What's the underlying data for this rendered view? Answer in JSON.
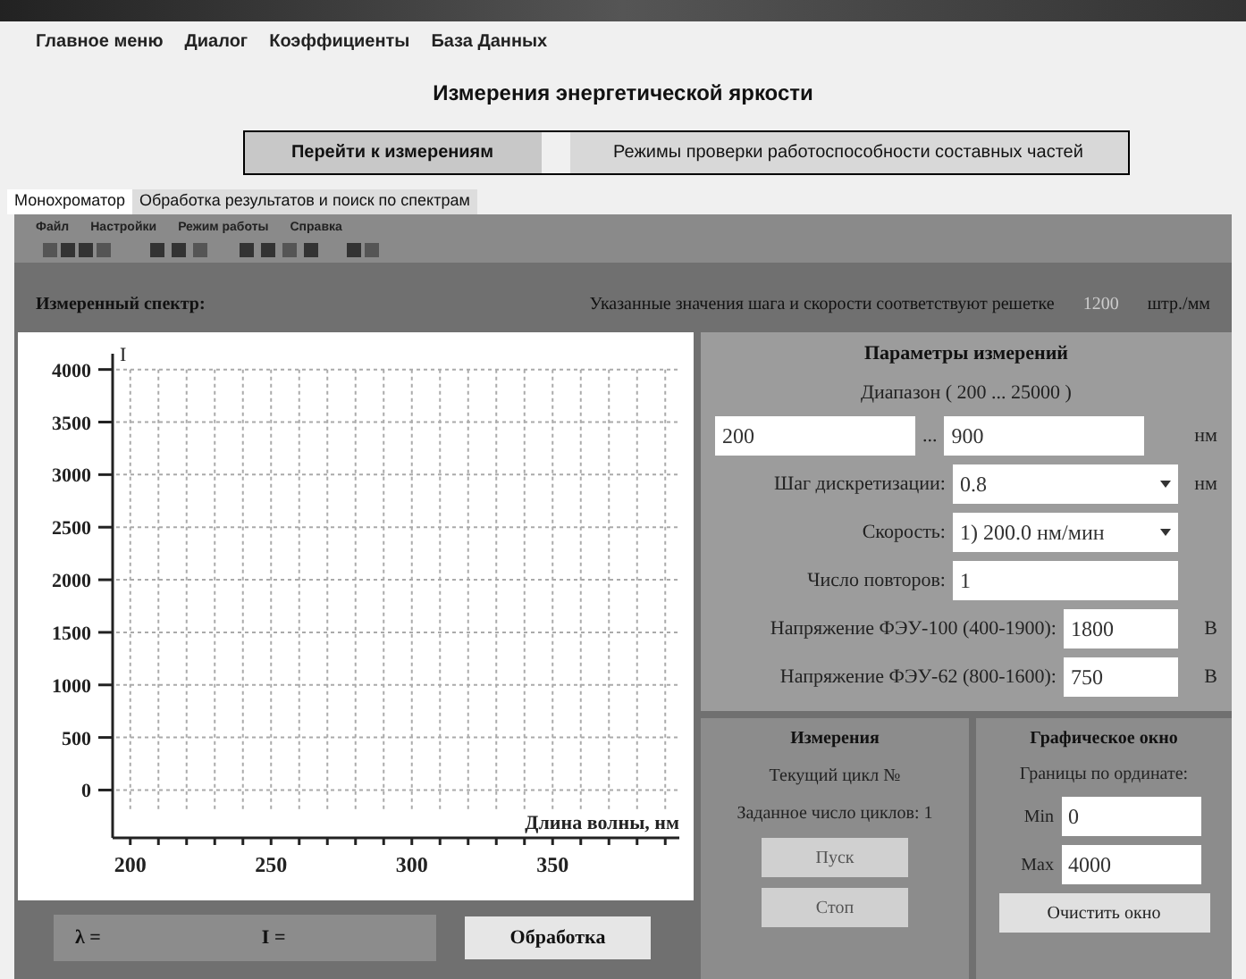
{
  "menu": [
    "Главное меню",
    "Диалог",
    "Коэффициенты",
    "База Данных"
  ],
  "title": "Измерения энергетической яркости",
  "mode_buttons": [
    {
      "label": "Перейти к измерениям",
      "selected": true
    },
    {
      "label": "Режимы проверки работоспособности составных частей",
      "selected": false
    }
  ],
  "tabs": [
    {
      "label": "Монохроматор",
      "selected": true
    },
    {
      "label": "Обработка результатов и поиск по спектрам",
      "selected": false
    }
  ],
  "inner_menu": [
    "Файл",
    "Настройки",
    "Режим работы",
    "Справка"
  ],
  "spectrum_label": "Измеренный спектр:",
  "note": "Указанные значения шага и скорости соответствуют решетке",
  "grating": "1200",
  "grating_unit": "штр./мм",
  "chart_data": {
    "type": "line",
    "xlabel": "Длина волны, нм",
    "ylabel": "I",
    "grid": true,
    "xlim": [
      195,
      395
    ],
    "ylim": [
      -200,
      4150
    ],
    "xticks": [
      200,
      250,
      300,
      350
    ],
    "yticks": [
      0,
      500,
      1000,
      1500,
      2000,
      2500,
      3000,
      3500,
      4000
    ]
  },
  "params": {
    "title": "Параметры измерений",
    "range_label": "Диапазон ( 200 ... 25000 )",
    "from": "200",
    "range_sep": "...",
    "to": "900",
    "range_unit": "нм",
    "step_label": "Шаг дискретизации:",
    "step": "0.8",
    "step_unit": "нм",
    "speed_label": "Скорость:",
    "speed": "1)  200.0  нм/мин",
    "repeats_label": "Число повторов:",
    "repeats": "1",
    "v100_label": "Напряжение ФЭУ-100 (400-1900):",
    "v100": "1800",
    "v100_unit": "В",
    "v62_label": "Напряжение ФЭУ-62 (800-1600):",
    "v62": "750",
    "v62_unit": "В"
  },
  "measure": {
    "title": "Измерения",
    "current_cycle": "Текущий цикл №",
    "total_cycles": "Заданное число циклов: 1",
    "start": "Пуск",
    "stop": "Стоп"
  },
  "graph": {
    "title": "Графическое окно",
    "limits": "Границы по ординате:",
    "min_label": "Min",
    "min": "0",
    "max_label": "Max",
    "max": "4000",
    "clear": "Очистить окно"
  },
  "readout": {
    "lambda": "λ =",
    "intensity": "I ="
  },
  "process_button": "Обработка"
}
